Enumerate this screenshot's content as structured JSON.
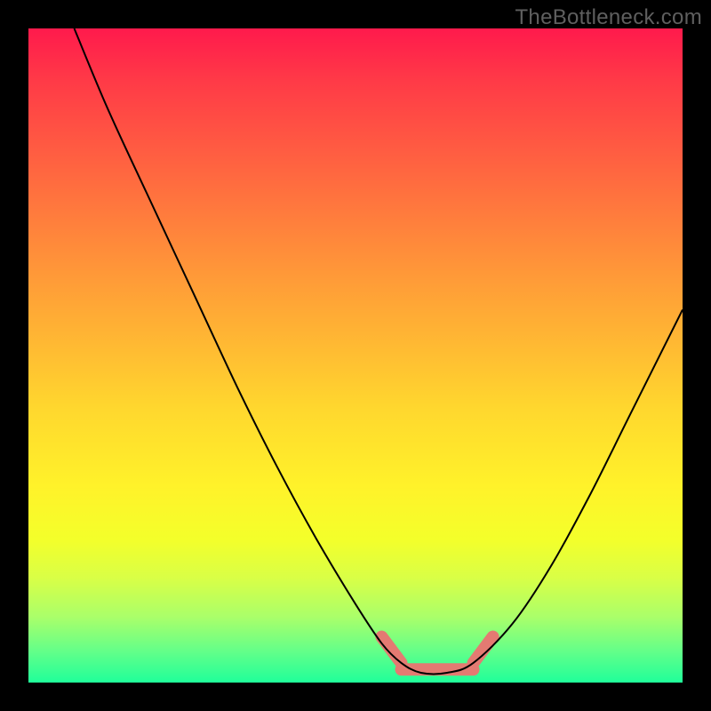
{
  "watermark": "TheBottleneck.com",
  "colors": {
    "coral": "#e47a72",
    "curve": "#000000"
  },
  "chart_data": {
    "type": "line",
    "title": "",
    "xlabel": "",
    "ylabel": "",
    "xlim": [
      0,
      100
    ],
    "ylim": [
      0,
      100
    ],
    "grid": false,
    "legend": false,
    "description": "V-shaped bottleneck curve on red-to-green vertical gradient; curve descends from upper-left to a flat trough around x≈56–68 then rises toward upper-right. Coral-colored thick segments mark the trough region.",
    "series": [
      {
        "name": "curve_left_branch",
        "x": [
          7,
          12,
          18,
          25,
          32,
          38,
          44,
          50,
          54,
          57
        ],
        "values": [
          100,
          88,
          75,
          60,
          45,
          33,
          22,
          12,
          6,
          3
        ]
      },
      {
        "name": "curve_trough",
        "x": [
          57,
          60,
          64,
          68
        ],
        "values": [
          3,
          1.5,
          1.5,
          3
        ]
      },
      {
        "name": "curve_right_branch",
        "x": [
          68,
          74,
          80,
          86,
          92,
          100
        ],
        "values": [
          3,
          9,
          18,
          29,
          41,
          57
        ]
      },
      {
        "name": "coral_highlight_left",
        "x": [
          54,
          57
        ],
        "values": [
          7,
          3
        ]
      },
      {
        "name": "coral_highlight_flat",
        "x": [
          57,
          68
        ],
        "values": [
          2,
          2
        ]
      },
      {
        "name": "coral_highlight_right",
        "x": [
          68,
          71
        ],
        "values": [
          3,
          7
        ]
      }
    ]
  }
}
